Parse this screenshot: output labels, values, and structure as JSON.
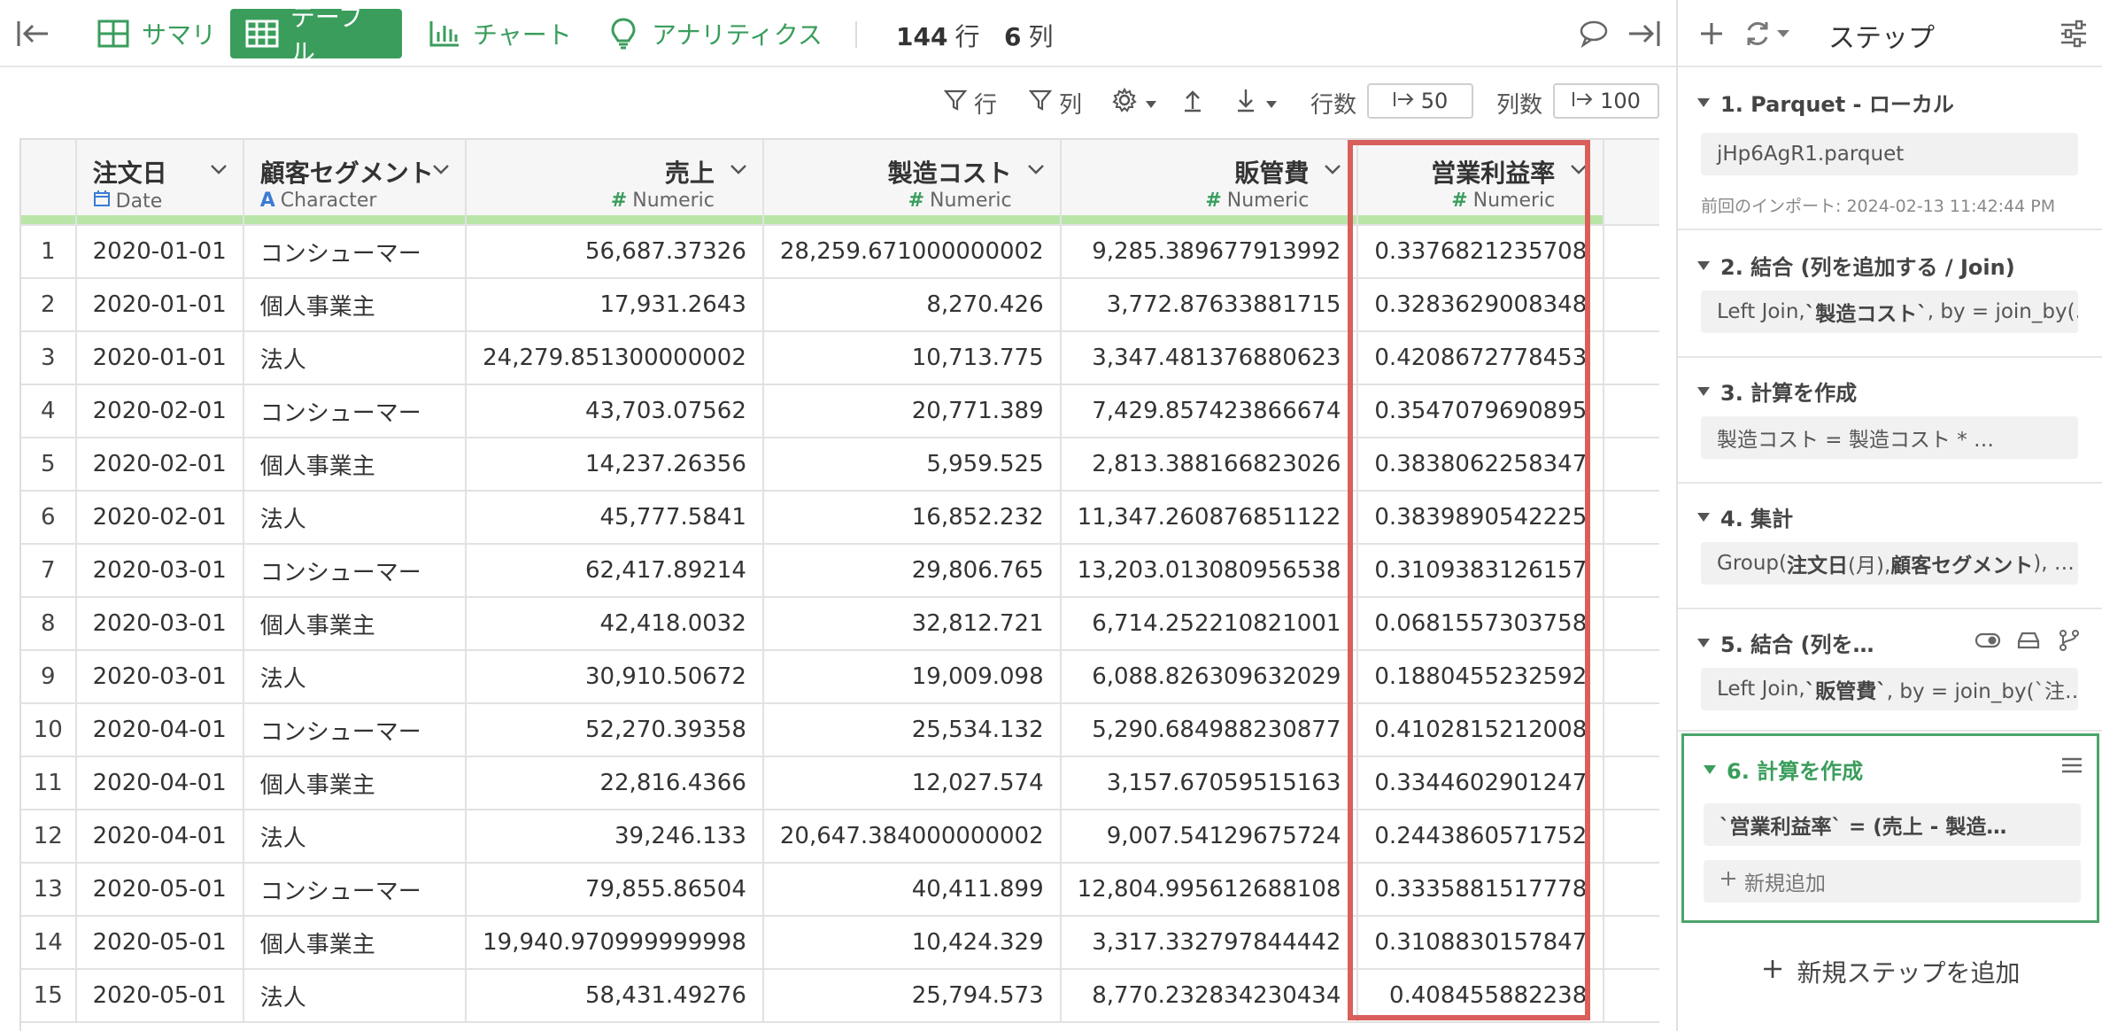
{
  "toolbar": {
    "nav": [
      {
        "label": "サマリ",
        "icon": "table-grid-icon"
      },
      {
        "label": "テーブル",
        "icon": "table-icon",
        "active": true
      },
      {
        "label": "チャート",
        "icon": "bar-chart-icon"
      },
      {
        "label": "アナリティクス",
        "icon": "lightbulb-icon"
      }
    ],
    "rows_count": "144",
    "rows_unit": "行",
    "cols_count": "6",
    "cols_unit": "列"
  },
  "subbar": {
    "row_filter": "行",
    "col_filter": "列",
    "rows_label": "行数",
    "rows_value": "50",
    "cols_label": "列数",
    "cols_value": "100"
  },
  "table": {
    "columns": [
      {
        "name": "注文日",
        "type": "Date",
        "type_icon": "calendar-icon",
        "align": "left"
      },
      {
        "name": "顧客セグメント",
        "type": "Character",
        "type_icon": "A",
        "align": "left"
      },
      {
        "name": "売上",
        "type": "Numeric",
        "type_icon": "#",
        "align": "right"
      },
      {
        "name": "製造コスト",
        "type": "Numeric",
        "type_icon": "#",
        "align": "right"
      },
      {
        "name": "販管費",
        "type": "Numeric",
        "type_icon": "#",
        "align": "right"
      },
      {
        "name": "営業利益率",
        "type": "Numeric",
        "type_icon": "#",
        "align": "right"
      }
    ],
    "rows": [
      [
        "1",
        "2020-01-01",
        "コンシューマー",
        "56,687.37326",
        "28,259.671000000002",
        "9,285.389677913992",
        "0.3376821235708"
      ],
      [
        "2",
        "2020-01-01",
        "個人事業主",
        "17,931.2643",
        "8,270.426",
        "3,772.87633881715",
        "0.3283629008348"
      ],
      [
        "3",
        "2020-01-01",
        "法人",
        "24,279.851300000002",
        "10,713.775",
        "3,347.481376880623",
        "0.4208672778453"
      ],
      [
        "4",
        "2020-02-01",
        "コンシューマー",
        "43,703.07562",
        "20,771.389",
        "7,429.857423866674",
        "0.3547079690895"
      ],
      [
        "5",
        "2020-02-01",
        "個人事業主",
        "14,237.26356",
        "5,959.525",
        "2,813.388166823026",
        "0.3838062258347"
      ],
      [
        "6",
        "2020-02-01",
        "法人",
        "45,777.5841",
        "16,852.232",
        "11,347.260876851122",
        "0.3839890542225"
      ],
      [
        "7",
        "2020-03-01",
        "コンシューマー",
        "62,417.89214",
        "29,806.765",
        "13,203.013080956538",
        "0.3109383126157"
      ],
      [
        "8",
        "2020-03-01",
        "個人事業主",
        "42,418.0032",
        "32,812.721",
        "6,714.252210821001",
        "0.0681557303758"
      ],
      [
        "9",
        "2020-03-01",
        "法人",
        "30,910.50672",
        "19,009.098",
        "6,088.826309632029",
        "0.1880455232592"
      ],
      [
        "10",
        "2020-04-01",
        "コンシューマー",
        "52,270.39358",
        "25,534.132",
        "5,290.684988230877",
        "0.4102815212008"
      ],
      [
        "11",
        "2020-04-01",
        "個人事業主",
        "22,816.4366",
        "12,027.574",
        "3,157.67059515163",
        "0.3344602901247"
      ],
      [
        "12",
        "2020-04-01",
        "法人",
        "39,246.133",
        "20,647.384000000002",
        "9,007.54129675724",
        "0.2443860571752"
      ],
      [
        "13",
        "2020-05-01",
        "コンシューマー",
        "79,855.86504",
        "40,411.899",
        "12,804.995612688108",
        "0.3335881517778"
      ],
      [
        "14",
        "2020-05-01",
        "個人事業主",
        "19,940.970999999998",
        "10,424.329",
        "3,317.332797844442",
        "0.3108830157847"
      ],
      [
        "15",
        "2020-05-01",
        "法人",
        "58,431.49276",
        "25,794.573",
        "8,770.232834230434",
        "0.408455882238"
      ]
    ]
  },
  "panel": {
    "title": "ステップ",
    "steps": [
      {
        "title": "1. Parquet - ローカル",
        "box": "jHp6AgR1.parquet",
        "note": "前回のインポート: 2024-02-13 11:42:44 PM"
      },
      {
        "title": "2. 結合 (列を追加する / Join)",
        "box_pre": "Left Join, ",
        "box_bold": "`製造コスト`",
        "box_post": ", by = join_by(…"
      },
      {
        "title": "3. 計算を作成",
        "box": "製造コスト = 製造コスト * …"
      },
      {
        "title": "4. 集計",
        "box_pre": "Group(",
        "box_bold": "注文日",
        "box_mid": " (月), ",
        "box_bold2": "顧客セグメント",
        "box_post": "), …"
      },
      {
        "title": "5. 結合 (列を…",
        "box_pre": "Left Join, ",
        "box_bold": "`販管費`",
        "box_post": ", by = join_by(`注…"
      },
      {
        "title": "6. 計算を作成",
        "box": "`営業利益率` = (売上 - 製造…",
        "add_label": "新規追加"
      }
    ],
    "add_step_label": "新規ステップを追加"
  },
  "colors": {
    "accent": "#3a9d5c",
    "highlight": "#d9605a",
    "header_strip": "#b9e6a8"
  }
}
